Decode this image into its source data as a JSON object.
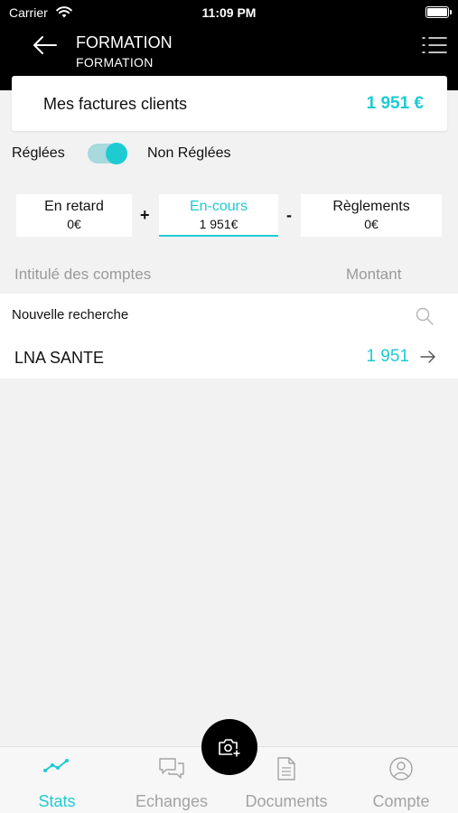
{
  "status_bar": {
    "carrier": "Carrier",
    "time": "11:09 PM"
  },
  "nav": {
    "title": "FORMATION",
    "subtitle": "FORMATION"
  },
  "invoice_card": {
    "label": "Mes factures clients",
    "amount": "1 951 €"
  },
  "toggle": {
    "left_label": "Réglées",
    "right_label": "Non Réglées",
    "state": "on"
  },
  "segments": [
    {
      "title": "En retard",
      "value": "0€"
    },
    {
      "title": "En-cours",
      "value": "1 951€"
    },
    {
      "title": "Règlements",
      "value": "0€"
    }
  ],
  "operators": {
    "plus": "+",
    "minus": "-"
  },
  "columns": {
    "name": "Intitulé des comptes",
    "amount": "Montant"
  },
  "search": {
    "label": "Nouvelle recherche"
  },
  "accounts": [
    {
      "name": "LNA SANTE",
      "amount": "1 951"
    }
  ],
  "tabs": [
    {
      "label": "Stats",
      "icon": "chart-line-icon"
    },
    {
      "label": "Echanges",
      "icon": "chat-bubbles-icon"
    },
    {
      "label": "Documents",
      "icon": "document-icon"
    },
    {
      "label": "Compte",
      "icon": "user-circle-icon"
    }
  ],
  "colors": {
    "accent": "#1ecbd3",
    "header": "#000000",
    "background": "#f2f2f2",
    "muted": "#a3a3a3"
  }
}
